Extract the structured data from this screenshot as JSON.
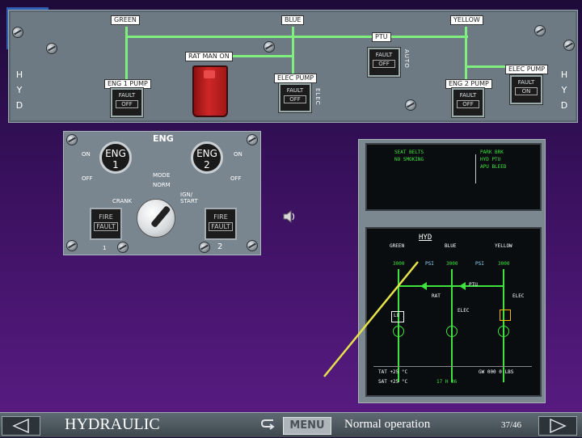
{
  "hyd_panel": {
    "side_left": [
      "H",
      "Y",
      "D"
    ],
    "side_right": [
      "H",
      "Y",
      "D"
    ],
    "systems": {
      "green": "GREEN",
      "blue": "BLUE",
      "yellow": "YELLOW"
    },
    "ptu_label": "PTU",
    "ptu_btn": {
      "top": "FAULT",
      "bottom": "OFF"
    },
    "auto_label": "AUTO",
    "ratman_label": "RAT MAN ON",
    "elec_pump_label": "ELEC PUMP",
    "elec_label": "ELEC",
    "eng1_pump": {
      "label": "ENG 1 PUMP",
      "top": "FAULT",
      "bottom": "OFF"
    },
    "elec_pump_blue": {
      "label": "ELEC PUMP",
      "top": "FAULT",
      "bottom": "OFF"
    },
    "eng2_pump": {
      "label": "ENG 2 PUMP",
      "top": "FAULT",
      "bottom": "OFF"
    },
    "elec_pump_yellow": {
      "label": "ELEC PUMP",
      "top": "FAULT",
      "bottom": "ON"
    }
  },
  "eng_panel": {
    "title": "ENG",
    "eng1": "ENG 1",
    "eng2": "ENG 2",
    "on_l": "ON",
    "off_l": "OFF",
    "on_r": "ON",
    "off_r": "OFF",
    "mode": "MODE",
    "norm": "NORM",
    "crank": "CRANK",
    "ign_start": "IGN/ START",
    "fire": "FIRE",
    "fault": "FAULT",
    "num_1": "1",
    "num_2": "2"
  },
  "ecam": {
    "upper_left": [
      "SEAT BELTS",
      "NO SMOKING"
    ],
    "upper_right": [
      "PARK BRK",
      "HYD PTU",
      "APU BLEED"
    ],
    "title": "HYD",
    "green": "GREEN",
    "blue": "BLUE",
    "yellow": "YELLOW",
    "green_psi": "3000",
    "blue_psi": "3000",
    "yellow_psi": "3000",
    "psi_l": "PSI",
    "psi_r": "PSI",
    "ptu": "PTU",
    "rat": "RAT",
    "elec_center": "ELEC",
    "elec_right": "ELEC",
    "lo": "LO",
    "tat": "TAT  +25 °C",
    "sat": "SAT  +25 °C",
    "time": "17 H 36",
    "gw": "GW  000 0 LBS"
  },
  "bottom": {
    "title": "HYDRAULIC",
    "menu": "MENU",
    "status": "Normal operation",
    "page": "37/46"
  },
  "colors": {
    "ecam_green": "#3fe33f",
    "pointer_yellow": "#e6e34a",
    "fire_red": "#cc2020"
  }
}
